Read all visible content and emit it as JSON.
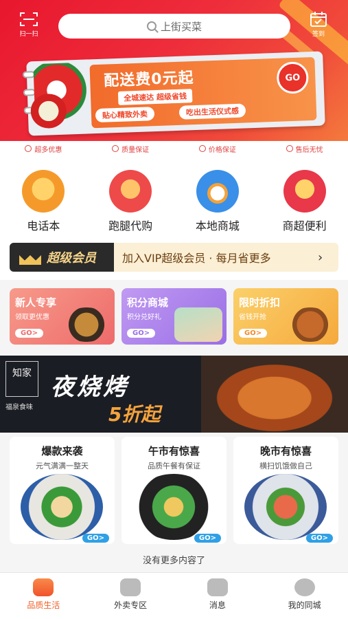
{
  "header": {
    "scan_label": "扫一扫",
    "checkin_label": "签到",
    "search_placeholder": "上街买菜"
  },
  "banner": {
    "title": "配送费0元起",
    "tag": "全城速达 超级省钱",
    "go": "GO",
    "sub1": "贴心精致外卖",
    "sub2": "吃出生活仪式感"
  },
  "guarantees": [
    "超多优惠",
    "质量保证",
    "价格保证",
    "售后无忧"
  ],
  "categories": [
    {
      "label": "电话本",
      "icon": "phonebook-icon",
      "color": "#f59a2a"
    },
    {
      "label": "跑腿代购",
      "icon": "errand-icon",
      "color": "#ee4a4a"
    },
    {
      "label": "本地商城",
      "icon": "store-icon",
      "color": "#3a8fe8"
    },
    {
      "label": "商超便利",
      "icon": "sale-icon",
      "color": "#e8384a"
    }
  ],
  "vip": {
    "title": "超级会员",
    "text": "加入VIP超级会员 · 每月省更多",
    "arrow": "›"
  },
  "promos": [
    {
      "title": "新人专享",
      "sub": "领取更优惠",
      "go": "GO>",
      "color": "#f07a76"
    },
    {
      "title": "积分商城",
      "sub": "积分兑好礼",
      "go": "GO>",
      "color": "#a77be8"
    },
    {
      "title": "限时折扣",
      "sub": "省钱开抢",
      "go": "GO>",
      "color": "#f4b23e"
    }
  ],
  "bbq": {
    "logo": "知家",
    "title": "夜烧烤",
    "discount": "5折起",
    "small": "福泉食味"
  },
  "deals": [
    {
      "title": "爆款来袭",
      "sub": "元气满满一整天",
      "go": "GO>"
    },
    {
      "title": "午市有惊喜",
      "sub": "品质午餐有保证",
      "go": "GO>"
    },
    {
      "title": "晚市有惊喜",
      "sub": "横扫饥饿做自己",
      "go": "GO>"
    }
  ],
  "footer_text": "没有更多内容了",
  "tabs": [
    {
      "label": "品质生活",
      "icon": "home-icon",
      "active": true
    },
    {
      "label": "外卖专区",
      "icon": "bag-icon",
      "active": false
    },
    {
      "label": "消息",
      "icon": "message-icon",
      "active": false
    },
    {
      "label": "我的同城",
      "icon": "profile-icon",
      "active": false
    }
  ]
}
